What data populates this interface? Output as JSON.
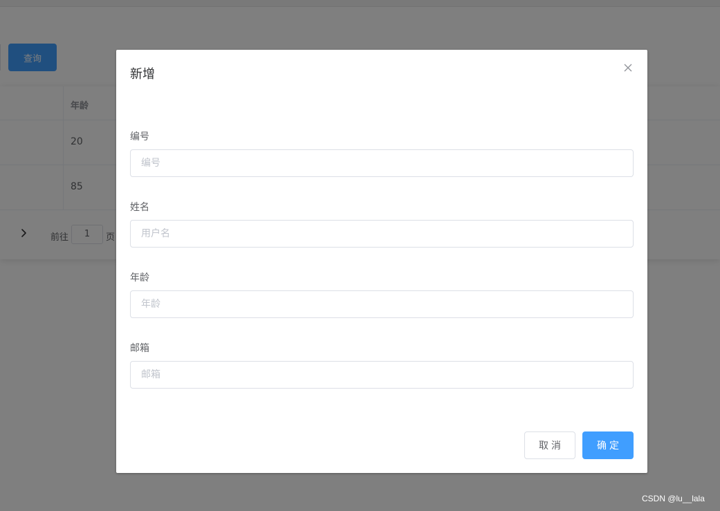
{
  "background": {
    "query_button_label": "查询",
    "table": {
      "columns": [
        "年龄"
      ],
      "rows": [
        {
          "age": "20"
        },
        {
          "age": "85"
        }
      ]
    },
    "pagination": {
      "next_icon": "chevron-right-icon",
      "goto_label": "前往",
      "current_page": "1",
      "page_unit_label": "页"
    }
  },
  "dialog": {
    "title": "新增",
    "close_icon": "close-icon",
    "fields": [
      {
        "label": "编号",
        "placeholder": "编号",
        "value": ""
      },
      {
        "label": "姓名",
        "placeholder": "用户名",
        "value": ""
      },
      {
        "label": "年龄",
        "placeholder": "年龄",
        "value": ""
      },
      {
        "label": "邮箱",
        "placeholder": "邮箱",
        "value": ""
      }
    ],
    "cancel_label": "取消",
    "confirm_label": "确定"
  },
  "watermark": "CSDN @lu__lala",
  "colors": {
    "primary": "#409eff",
    "overlay": "rgba(0,0,0,0.5)",
    "border": "#dcdfe6",
    "placeholder": "#c0c4cc"
  }
}
